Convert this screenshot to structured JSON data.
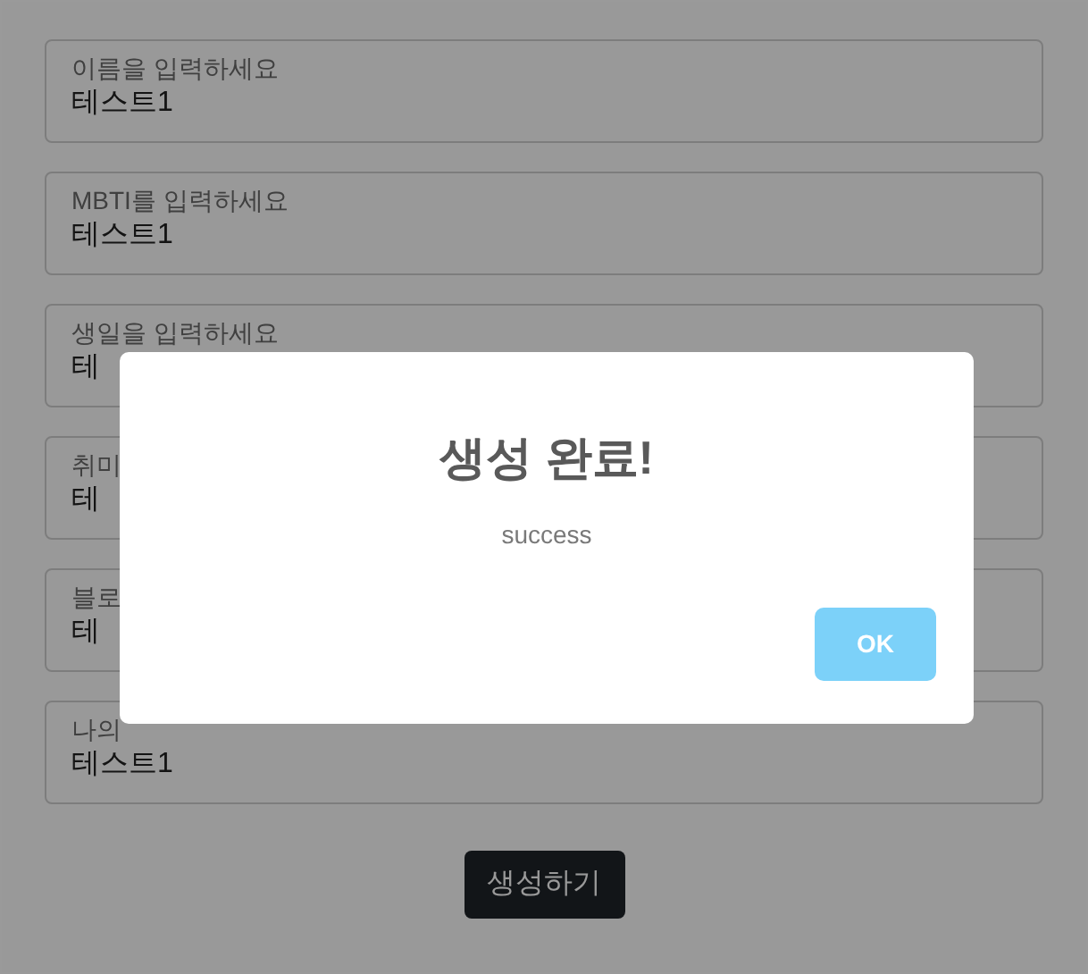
{
  "fields": [
    {
      "label": "이름을 입력하세요",
      "value": "테스트1"
    },
    {
      "label": "MBTI를 입력하세요",
      "value": "테스트1"
    },
    {
      "label": "생일을 입력하세요",
      "value": "테"
    },
    {
      "label": "취미",
      "value": "테"
    },
    {
      "label": "블로",
      "value": "테"
    },
    {
      "label": "나의",
      "value": "테스트1"
    }
  ],
  "submit_button": "생성하기",
  "dialog": {
    "title": "생성 완료!",
    "message": "success",
    "button": "OK"
  }
}
